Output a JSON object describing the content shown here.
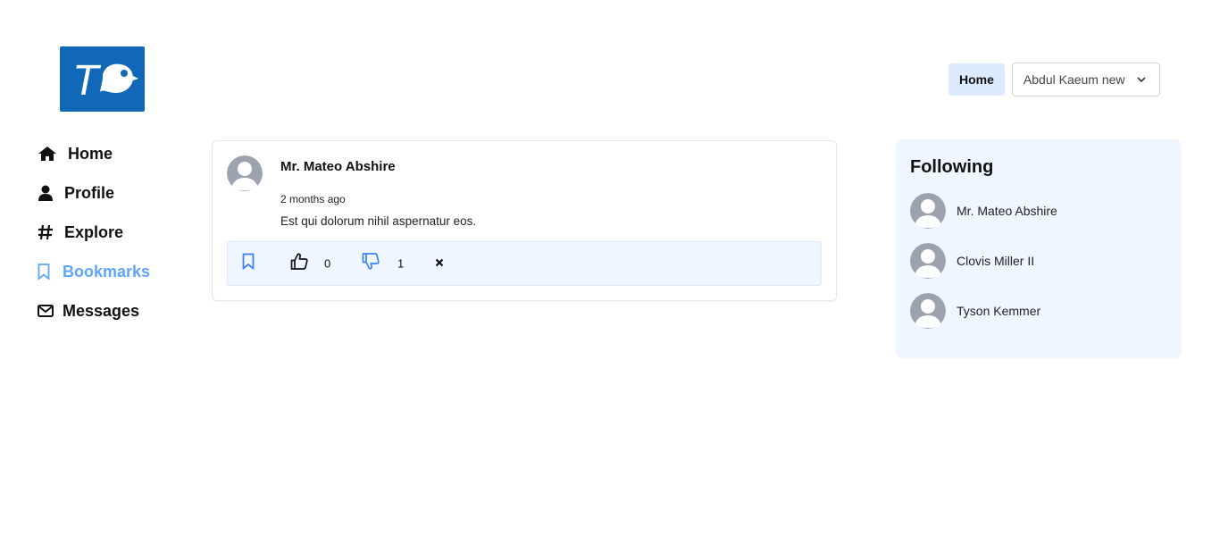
{
  "brand": {
    "logo_icon": "twitter-clone-bird-logo",
    "logo_letter": "T",
    "color": "#1168b8"
  },
  "topnav": {
    "home_label": "Home",
    "user_name": "Abdul Kaeum new",
    "user_chevron_icon": "chevron-down-icon"
  },
  "sidebar": {
    "items": [
      {
        "label": "Home",
        "icon": "home-icon",
        "active": false
      },
      {
        "label": "Profile",
        "icon": "user-icon",
        "active": false
      },
      {
        "label": "Explore",
        "icon": "hashtag-icon",
        "active": false
      },
      {
        "label": "Bookmarks",
        "icon": "bookmark-icon",
        "active": true
      },
      {
        "label": "Messages",
        "icon": "envelope-icon",
        "active": false
      }
    ],
    "active_color": "#60a5fa"
  },
  "post": {
    "author": "Mr. Mateo Abshire",
    "time": "2 months ago",
    "body": "Est qui dolorum nihil aspernatur eos.",
    "likes": "0",
    "dislikes": "1",
    "bookmarked": true
  },
  "following": {
    "title": "Following",
    "users": [
      {
        "name": "Mr. Mateo Abshire"
      },
      {
        "name": "Clovis Miller II"
      },
      {
        "name": "Tyson Kemmer"
      }
    ]
  },
  "colors": {
    "accent": "#3b82f6",
    "panel_bg": "#eff6ff",
    "home_pill_bg": "#dbeafe"
  }
}
